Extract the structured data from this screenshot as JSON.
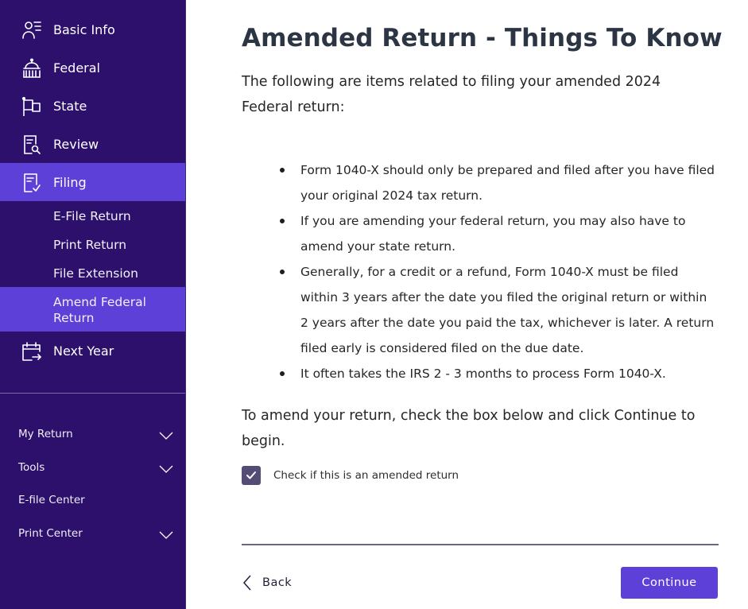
{
  "sidebar": {
    "nav": [
      {
        "label": "Basic Info",
        "icon": "person-list-icon"
      },
      {
        "label": "Federal",
        "icon": "capitol-icon"
      },
      {
        "label": "State",
        "icon": "flag-icon"
      },
      {
        "label": "Review",
        "icon": "document-search-icon"
      },
      {
        "label": "Filing",
        "icon": "document-check-icon",
        "active": true
      },
      {
        "label": "Next Year",
        "icon": "calendar-arrow-icon"
      }
    ],
    "sub_items": [
      {
        "label": "E-File Return"
      },
      {
        "label": "Print Return"
      },
      {
        "label": "File Extension"
      },
      {
        "label": "Amend Federal Return",
        "active": true
      }
    ],
    "footer": [
      {
        "label": "My Return",
        "expandable": true
      },
      {
        "label": "Tools",
        "expandable": true
      },
      {
        "label": "E-file Center",
        "expandable": false
      },
      {
        "label": "Print Center",
        "expandable": true
      }
    ]
  },
  "main": {
    "title": "Amended Return - Things To Know",
    "intro": "The following are items related to filing your amended 2024 Federal return:",
    "bullets": [
      "Form 1040-X should only be prepared and filed after you have filed your original 2024 tax return.",
      "If you are amending your federal return, you may also have to amend your state return.",
      "Generally, for a credit or a refund, Form 1040-X must be filed within 3 years after the date you filed the original return or within 2 years after the date you paid the tax, whichever is later. A return filed early is considered filed on the due date.",
      "It often takes the IRS 2 - 3 months to process Form 1040-X."
    ],
    "instruction": "To amend your return, check the box below and click Continue to begin.",
    "checkbox": {
      "label": "Check if this is an amended return",
      "checked": true
    }
  },
  "footer_nav": {
    "back_label": "Back",
    "continue_label": "Continue"
  },
  "colors": {
    "sidebar_bg": "#2c106b",
    "active_bg": "#5c40d8",
    "primary_button": "#5c40d8",
    "checkbox": "#544c75",
    "title": "#2b3544"
  }
}
